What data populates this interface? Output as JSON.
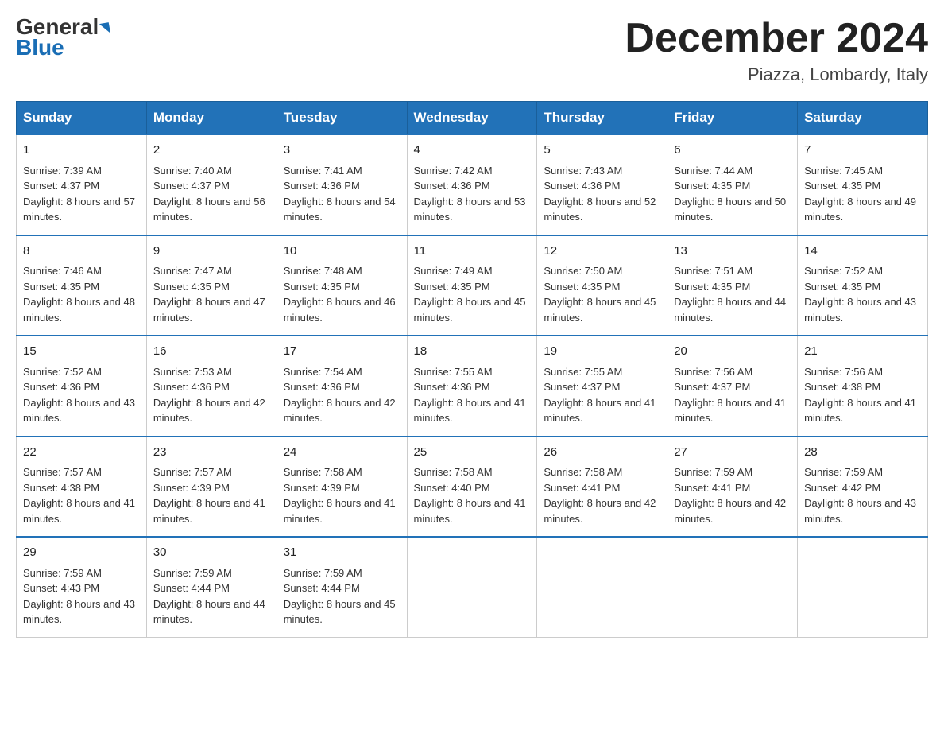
{
  "header": {
    "logo_line1": "General",
    "logo_line2": "Blue",
    "month_title": "December 2024",
    "location": "Piazza, Lombardy, Italy"
  },
  "days_of_week": [
    "Sunday",
    "Monday",
    "Tuesday",
    "Wednesday",
    "Thursday",
    "Friday",
    "Saturday"
  ],
  "weeks": [
    [
      {
        "day": "1",
        "sunrise": "7:39 AM",
        "sunset": "4:37 PM",
        "daylight": "8 hours and 57 minutes."
      },
      {
        "day": "2",
        "sunrise": "7:40 AM",
        "sunset": "4:37 PM",
        "daylight": "8 hours and 56 minutes."
      },
      {
        "day": "3",
        "sunrise": "7:41 AM",
        "sunset": "4:36 PM",
        "daylight": "8 hours and 54 minutes."
      },
      {
        "day": "4",
        "sunrise": "7:42 AM",
        "sunset": "4:36 PM",
        "daylight": "8 hours and 53 minutes."
      },
      {
        "day": "5",
        "sunrise": "7:43 AM",
        "sunset": "4:36 PM",
        "daylight": "8 hours and 52 minutes."
      },
      {
        "day": "6",
        "sunrise": "7:44 AM",
        "sunset": "4:35 PM",
        "daylight": "8 hours and 50 minutes."
      },
      {
        "day": "7",
        "sunrise": "7:45 AM",
        "sunset": "4:35 PM",
        "daylight": "8 hours and 49 minutes."
      }
    ],
    [
      {
        "day": "8",
        "sunrise": "7:46 AM",
        "sunset": "4:35 PM",
        "daylight": "8 hours and 48 minutes."
      },
      {
        "day": "9",
        "sunrise": "7:47 AM",
        "sunset": "4:35 PM",
        "daylight": "8 hours and 47 minutes."
      },
      {
        "day": "10",
        "sunrise": "7:48 AM",
        "sunset": "4:35 PM",
        "daylight": "8 hours and 46 minutes."
      },
      {
        "day": "11",
        "sunrise": "7:49 AM",
        "sunset": "4:35 PM",
        "daylight": "8 hours and 45 minutes."
      },
      {
        "day": "12",
        "sunrise": "7:50 AM",
        "sunset": "4:35 PM",
        "daylight": "8 hours and 45 minutes."
      },
      {
        "day": "13",
        "sunrise": "7:51 AM",
        "sunset": "4:35 PM",
        "daylight": "8 hours and 44 minutes."
      },
      {
        "day": "14",
        "sunrise": "7:52 AM",
        "sunset": "4:35 PM",
        "daylight": "8 hours and 43 minutes."
      }
    ],
    [
      {
        "day": "15",
        "sunrise": "7:52 AM",
        "sunset": "4:36 PM",
        "daylight": "8 hours and 43 minutes."
      },
      {
        "day": "16",
        "sunrise": "7:53 AM",
        "sunset": "4:36 PM",
        "daylight": "8 hours and 42 minutes."
      },
      {
        "day": "17",
        "sunrise": "7:54 AM",
        "sunset": "4:36 PM",
        "daylight": "8 hours and 42 minutes."
      },
      {
        "day": "18",
        "sunrise": "7:55 AM",
        "sunset": "4:36 PM",
        "daylight": "8 hours and 41 minutes."
      },
      {
        "day": "19",
        "sunrise": "7:55 AM",
        "sunset": "4:37 PM",
        "daylight": "8 hours and 41 minutes."
      },
      {
        "day": "20",
        "sunrise": "7:56 AM",
        "sunset": "4:37 PM",
        "daylight": "8 hours and 41 minutes."
      },
      {
        "day": "21",
        "sunrise": "7:56 AM",
        "sunset": "4:38 PM",
        "daylight": "8 hours and 41 minutes."
      }
    ],
    [
      {
        "day": "22",
        "sunrise": "7:57 AM",
        "sunset": "4:38 PM",
        "daylight": "8 hours and 41 minutes."
      },
      {
        "day": "23",
        "sunrise": "7:57 AM",
        "sunset": "4:39 PM",
        "daylight": "8 hours and 41 minutes."
      },
      {
        "day": "24",
        "sunrise": "7:58 AM",
        "sunset": "4:39 PM",
        "daylight": "8 hours and 41 minutes."
      },
      {
        "day": "25",
        "sunrise": "7:58 AM",
        "sunset": "4:40 PM",
        "daylight": "8 hours and 41 minutes."
      },
      {
        "day": "26",
        "sunrise": "7:58 AM",
        "sunset": "4:41 PM",
        "daylight": "8 hours and 42 minutes."
      },
      {
        "day": "27",
        "sunrise": "7:59 AM",
        "sunset": "4:41 PM",
        "daylight": "8 hours and 42 minutes."
      },
      {
        "day": "28",
        "sunrise": "7:59 AM",
        "sunset": "4:42 PM",
        "daylight": "8 hours and 43 minutes."
      }
    ],
    [
      {
        "day": "29",
        "sunrise": "7:59 AM",
        "sunset": "4:43 PM",
        "daylight": "8 hours and 43 minutes."
      },
      {
        "day": "30",
        "sunrise": "7:59 AM",
        "sunset": "4:44 PM",
        "daylight": "8 hours and 44 minutes."
      },
      {
        "day": "31",
        "sunrise": "7:59 AM",
        "sunset": "4:44 PM",
        "daylight": "8 hours and 45 minutes."
      },
      null,
      null,
      null,
      null
    ]
  ],
  "labels": {
    "sunrise": "Sunrise:",
    "sunset": "Sunset:",
    "daylight": "Daylight:"
  }
}
